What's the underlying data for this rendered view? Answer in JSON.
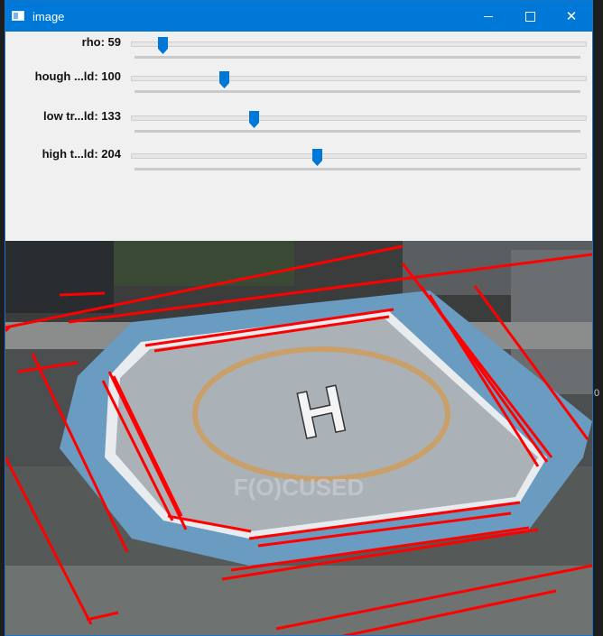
{
  "window": {
    "title": "image",
    "icon": "app-window-icon",
    "buttons": {
      "minimize": "—",
      "maximize": "☐",
      "close": "✕"
    }
  },
  "trackbars": [
    {
      "label": "rho: 59",
      "value": 59,
      "fraction": 0.07
    },
    {
      "label": "hough ...ld: 100",
      "value": 100,
      "fraction": 0.205
    },
    {
      "label": "low tr...ld: 133",
      "value": 133,
      "fraction": 0.27
    },
    {
      "label": "high t...ld: 204",
      "value": 204,
      "fraction": 0.41
    }
  ],
  "image": {
    "watermark": "F(O)CUSED",
    "helipad_letter": "H",
    "line_color": "#ff0000"
  },
  "background_edge_text": "0"
}
